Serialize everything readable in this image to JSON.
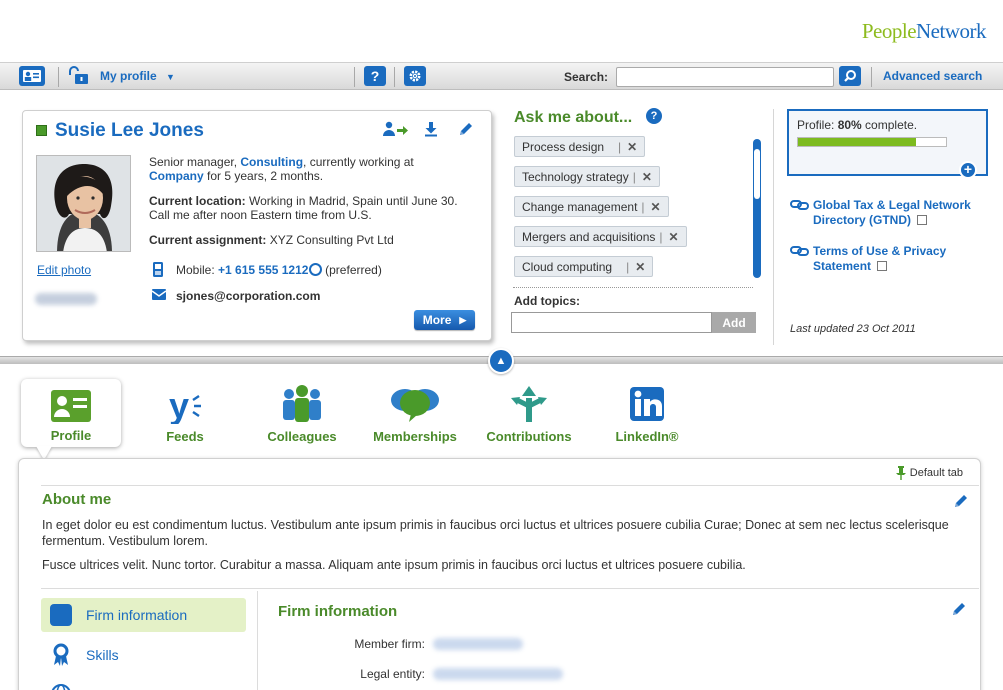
{
  "brand": {
    "people": "People",
    "network": "Network"
  },
  "navbar": {
    "my_profile": "My profile",
    "help": "?",
    "search_label": "Search:",
    "search_value": "",
    "advanced_search": "Advanced search"
  },
  "profile_card": {
    "name": "Susie Lee Jones",
    "bio_pre": "Senior manager, ",
    "bio_link1": "Consulting",
    "bio_mid": ", currently working at",
    "bio_link2": "Company",
    "bio_post": " for 5 years, 2 months.",
    "location_label": "Current location:",
    "location_value": " Working in Madrid, Spain until June 30. Call me after noon Eastern time from U.S.",
    "assignment_label": "Current assignment:",
    "assignment_value": " XYZ Consulting Pvt Ltd",
    "edit_photo": "Edit photo",
    "mobile_label": "Mobile:",
    "mobile_number": "+1 615 555 1212",
    "mobile_note": "(preferred)",
    "email": "sjones@corporation.com",
    "more": "More"
  },
  "ask": {
    "title": "Ask me about...",
    "topics": [
      "Process design",
      "Technology strategy",
      "Change management",
      "Mergers and acquisitions",
      "Cloud computing"
    ],
    "add_topics_label": "Add topics:",
    "add_value": "",
    "add_button": "Add"
  },
  "profile_status": {
    "text_pre": "Profile: ",
    "percent_text": "80%",
    "text_post": " complete.",
    "percent": 80
  },
  "links": {
    "gtnd": "Global Tax & Legal Network Directory (GTND)",
    "terms": "Terms of Use & Privacy Statement",
    "last_updated": "Last updated 23 Oct 2011"
  },
  "tabs": [
    "Profile",
    "Feeds",
    "Colleagues",
    "Memberships",
    "Contributions",
    "LinkedIn®"
  ],
  "main": {
    "default_tab": "Default tab",
    "about_title": "About me",
    "about_p1": "In eget dolor eu est condimentum luctus. Vestibulum ante ipsum primis in faucibus orci luctus et ultrices posuere cubilia Curae; Donec at sem nec lectus scelerisque fermentum. Vestibulum lorem.",
    "about_p2": "Fusce ultrices velit. Nunc tortor. Curabitur a massa. Aliquam ante ipsum primis in faucibus orci luctus et ultrices posuere cubilia.",
    "sidebar": [
      "Firm information",
      "Skills"
    ],
    "firm_title": "Firm information",
    "member_firm_label": "Member firm:",
    "legal_entity_label": "Legal entity:"
  },
  "colors": {
    "accent": "#1a6bbf",
    "green": "#4a8a2a",
    "progress": "#7dbb1f"
  }
}
